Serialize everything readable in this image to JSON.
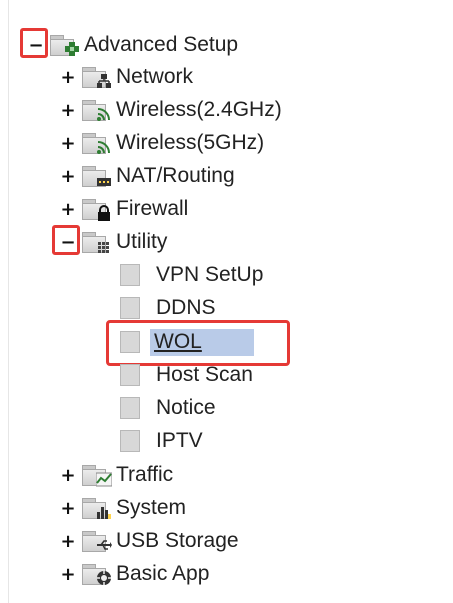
{
  "tree": {
    "root": {
      "toggle": "−",
      "label": "Advanced Setup",
      "icon": "folder-plus-icon"
    },
    "items": [
      {
        "toggle": "+",
        "label": "Network",
        "icon": "network-icon"
      },
      {
        "toggle": "+",
        "label": "Wireless(2.4GHz)",
        "icon": "wifi-icon"
      },
      {
        "toggle": "+",
        "label": "Wireless(5GHz)",
        "icon": "wifi-icon"
      },
      {
        "toggle": "+",
        "label": "NAT/Routing",
        "icon": "router-icon"
      },
      {
        "toggle": "+",
        "label": "Firewall",
        "icon": "lock-icon"
      },
      {
        "toggle": "−",
        "label": "Utility",
        "icon": "grid-icon"
      },
      {
        "toggle": "+",
        "label": "Traffic",
        "icon": "chart-line-icon"
      },
      {
        "toggle": "+",
        "label": "System",
        "icon": "bar-chart-icon"
      },
      {
        "toggle": "+",
        "label": "USB Storage",
        "icon": "usb-icon"
      },
      {
        "toggle": "+",
        "label": "Basic App",
        "icon": "gear-icon"
      }
    ],
    "utility_children": [
      {
        "label": "VPN SetUp"
      },
      {
        "label": "DDNS"
      },
      {
        "label": "WOL",
        "selected": true
      },
      {
        "label": "Host Scan"
      },
      {
        "label": "Notice"
      },
      {
        "label": "IPTV"
      }
    ]
  },
  "colors": {
    "highlight_border": "#e53935",
    "selection_bg": "#b9cbe8"
  }
}
